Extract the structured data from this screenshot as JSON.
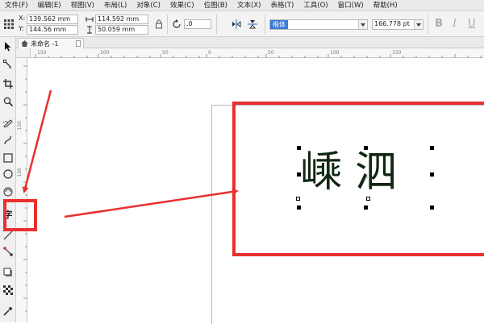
{
  "menu": [
    "文件(F)",
    "编辑(E)",
    "视图(V)",
    "布局(L)",
    "对象(C)",
    "效果(C)",
    "位图(B)",
    "文本(X)",
    "表格(T)",
    "工具(O)",
    "窗口(W)",
    "帮助(H)"
  ],
  "properties": {
    "x_label": "X:",
    "x_value": "139.562 mm",
    "y_label": "Y:",
    "y_value": "144.56 mm",
    "width_value": "114.592 mm",
    "height_value": "50.059 mm",
    "rotation_value": ".0",
    "font_name": "楷体",
    "font_size": "166.778 pt",
    "bold_label": "B",
    "italic_label": "I",
    "underline_label": "U"
  },
  "document_tab": {
    "label": "未命名 -1"
  },
  "ruler": {
    "h_ticks": [
      "150",
      "100",
      "50",
      "0",
      "50",
      "100",
      "150"
    ],
    "v_ticks": [
      "150",
      "100"
    ]
  },
  "canvas": {
    "art_text": "嵊泗"
  },
  "colors": {
    "accent": "#e8302f",
    "text": "#102812"
  },
  "tools": [
    "pick-tool",
    "shape-tool",
    "crop-tool",
    "zoom-tool",
    "freehand-tool",
    "curve-tool",
    "rectangle-tool",
    "ellipse-tool",
    "polygon-tool",
    "text-tool",
    "parallel-dimension-tool",
    "connector-tool",
    "drop-shadow-tool",
    "transparency-tool",
    "eyedropper-tool"
  ],
  "text_tool_label": "字"
}
